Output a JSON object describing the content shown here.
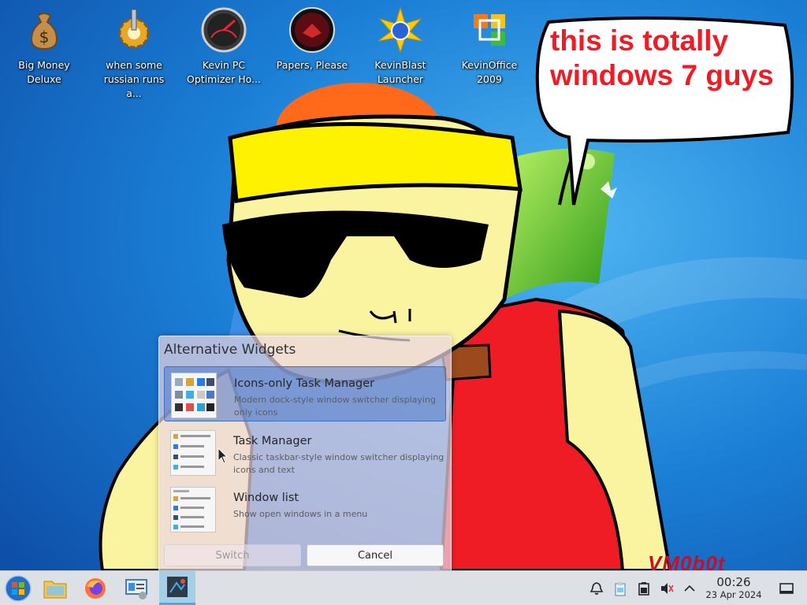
{
  "desktop": {
    "icons": [
      {
        "label": "Big Money\nDeluxe",
        "icon": "money-bag-icon"
      },
      {
        "label": "when some\nrussian runs a...",
        "icon": "gears-icon"
      },
      {
        "label": "Kevin PC\nOptimizer Ho...",
        "icon": "speedometer-icon"
      },
      {
        "label": "Papers, Please",
        "icon": "papers-please-icon"
      },
      {
        "label": "KevinBlast\nLauncher",
        "icon": "starburst-icon"
      },
      {
        "label": "KevinOffice\n2009",
        "icon": "office-logo-icon"
      }
    ],
    "speech_bubble": "this is totally windows 7 guys",
    "watermark": "VM0b0t"
  },
  "popup": {
    "title": "Alternative Widgets",
    "widgets": [
      {
        "name": "Icons-only Task Manager",
        "description": "Modern dock-style window switcher displaying only icons",
        "selected": true
      },
      {
        "name": "Task Manager",
        "description": "Classic taskbar-style window switcher displaying icons and text",
        "selected": false
      },
      {
        "name": "Window list",
        "description": "Show open windows in a menu",
        "selected": false
      }
    ],
    "switch_label": "Switch",
    "cancel_label": "Cancel"
  },
  "taskbar": {
    "launchers": [
      "start-orb-icon",
      "file-manager-icon",
      "firefox-icon",
      "system-settings-icon",
      "plasma-discover-icon"
    ],
    "tray": [
      "notifications-icon",
      "clipboard-icon",
      "battery-icon",
      "volume-muted-icon",
      "expand-tray-icon"
    ],
    "clock_time": "00:26",
    "clock_date": "23 Apr 2024",
    "accent": "#3daee9"
  }
}
